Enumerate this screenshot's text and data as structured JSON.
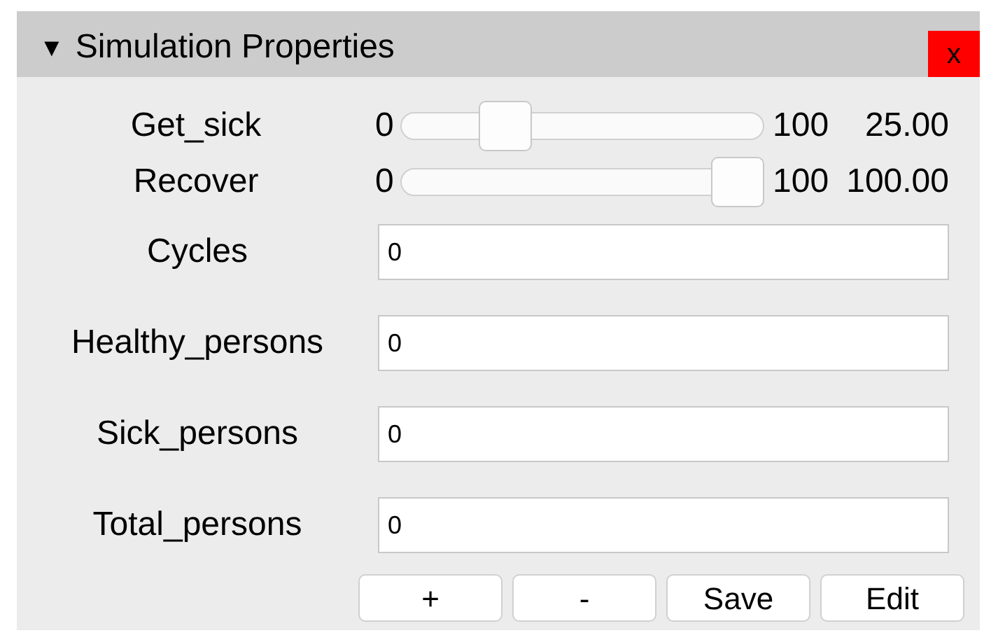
{
  "panel": {
    "collapse_glyph": "▼",
    "title": "Simulation Properties",
    "close_label": "x"
  },
  "sliders": [
    {
      "label": "Get_sick",
      "min": "0",
      "max": "100",
      "reading": "25.00",
      "level": 0.25
    },
    {
      "label": "Recover",
      "min": "0",
      "max": "100",
      "reading": "100.00",
      "level": 1.0
    }
  ],
  "fields": [
    {
      "label": "Cycles",
      "value": "0"
    },
    {
      "label": "Healthy_persons",
      "value": "0"
    },
    {
      "label": "Sick_persons",
      "value": "0"
    },
    {
      "label": "Total_persons",
      "value": "0"
    }
  ],
  "buttons": [
    "+",
    "-",
    "Save",
    "Edit"
  ]
}
